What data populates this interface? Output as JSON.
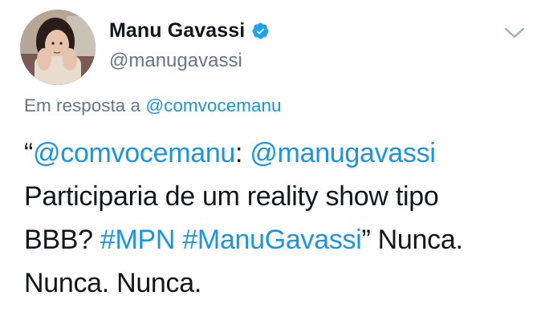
{
  "user": {
    "display_name": "Manu Gavassi",
    "handle": "@manugavassi",
    "verified": true,
    "avatar_alt": "profile photo"
  },
  "menu": {
    "icon": "chevron-down-icon"
  },
  "reply": {
    "prefix": "Em resposta a ",
    "to": "@comvocemanu"
  },
  "tweet": {
    "line1": {
      "open_quote": "“",
      "mention1": "@comvocemanu",
      "sep": ": ",
      "mention2": "@manugavassi"
    },
    "line2": {
      "text": "Participaria de um reality show tipo"
    },
    "line3": {
      "text_before": "BBB? ",
      "hashtag1": "#MPN",
      "space": " ",
      "hashtag2": "#ManuGavassi",
      "text_after": "” Nunca."
    },
    "line4": {
      "text": "Nunca. Nunca."
    }
  },
  "colors": {
    "link": "#1b95e0",
    "secondary_text": "#657786",
    "primary_text": "#14171a",
    "verified_badge": "#1da1f2"
  }
}
